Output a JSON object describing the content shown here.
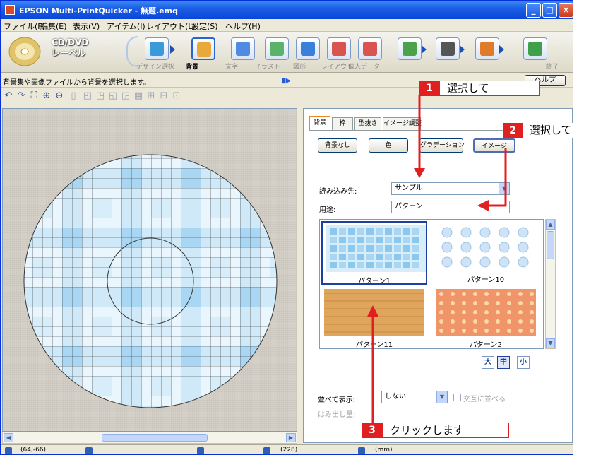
{
  "window": {
    "title": "EPSON Multi-PrintQuicker - 無題.emq"
  },
  "menu": [
    "ファイル(F)",
    "編集(E)",
    "表示(V)",
    "アイテム(I)",
    "レイアウト(L)",
    "設定(S)",
    "ヘルプ(H)"
  ],
  "media": {
    "line1": "CD/DVD",
    "line2": "レーベル"
  },
  "wizard": [
    {
      "label": "デザイン選択",
      "icon": "design-select-icon",
      "color": "#3a9ad9"
    },
    {
      "label": "背景",
      "icon": "background-icon",
      "color": "#e8a93a"
    },
    {
      "label": "文字",
      "icon": "text-icon",
      "color": "#4f8be0"
    },
    {
      "label": "イラスト",
      "icon": "illustration-icon",
      "color": "#5bb36a"
    },
    {
      "label": "図形",
      "icon": "shape-icon",
      "color": "#3a7fd9"
    },
    {
      "label": "レイアウト",
      "icon": "layout-icon",
      "color": "#d9534f"
    },
    {
      "label": "個人データ",
      "icon": "personal-data-icon",
      "color": "#d9534f"
    },
    {
      "label": "",
      "icon": "merge-icon",
      "color": "#4aa34a"
    },
    {
      "label": "",
      "icon": "printer-icon",
      "color": "#555555"
    },
    {
      "label": "",
      "icon": "save-icon",
      "color": "#e07b2a"
    },
    {
      "label": "終了",
      "icon": "exit-icon",
      "color": "#3fa04a"
    }
  ],
  "status": {
    "message": "背景集や画像ファイルから背景を選択します。",
    "help": "ヘルプ"
  },
  "panel": {
    "tabs": [
      "背景",
      "枠",
      "型抜き",
      "イメージ調整"
    ],
    "buttons": [
      "背景なし",
      "色",
      "グラデーション",
      "イメージ"
    ],
    "source_label": "読み込み先:",
    "source_value": "サンプル",
    "usage_label": "用途:",
    "usage_value": "パターン",
    "thumbnails": [
      {
        "caption": "パターン1",
        "pattern": "grid"
      },
      {
        "caption": "パターン10",
        "pattern": "circles"
      },
      {
        "caption": "パターン11",
        "pattern": "wood"
      },
      {
        "caption": "パターン2",
        "pattern": "floral"
      }
    ],
    "sizes": [
      "大",
      "中",
      "小"
    ],
    "tile_label": "並べて表示:",
    "tile_value": "しない",
    "alternate_label": "交互に並べる",
    "overflow_label": "はみ出し量:"
  },
  "statusbar": {
    "coords": "(64,-66)",
    "size": "(228)",
    "unit": "(mm)"
  },
  "annotations": [
    {
      "num": "1",
      "text": "選択して"
    },
    {
      "num": "2",
      "text": "選択して"
    },
    {
      "num": "3",
      "text": "クリックします"
    }
  ],
  "colors": {
    "accent_red": "#e02020",
    "title_blue": "#0a46d8"
  }
}
